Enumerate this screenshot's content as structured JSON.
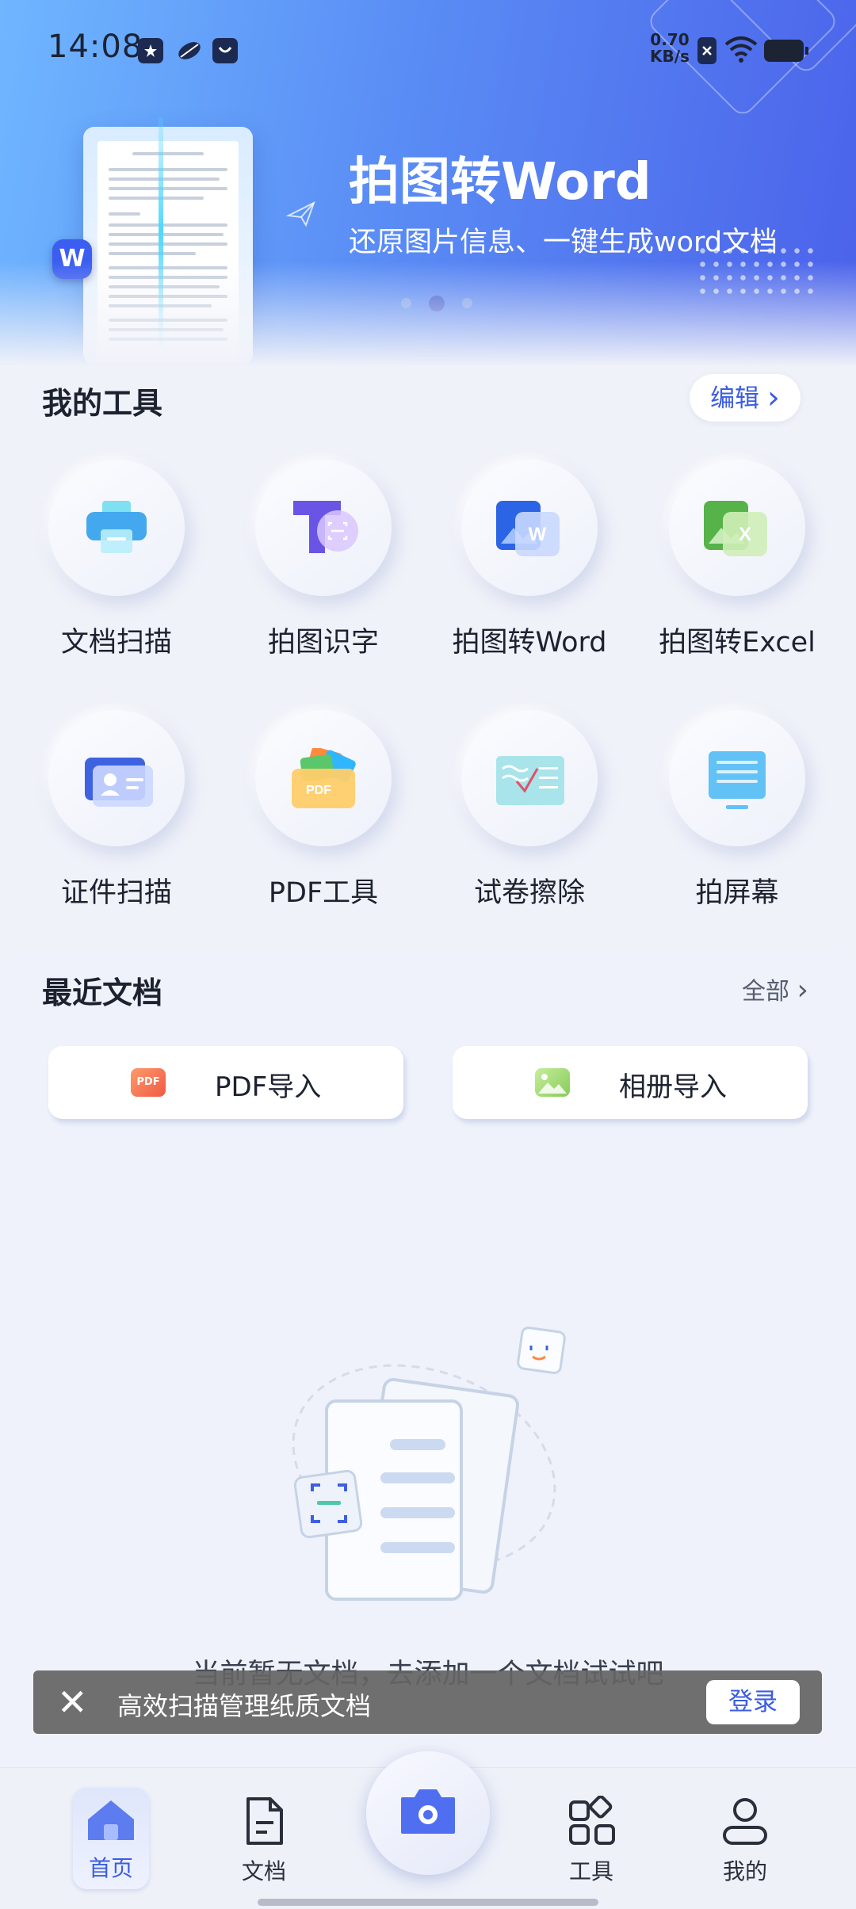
{
  "status_bar": {
    "time": "14:08",
    "speed_value": "0.70",
    "speed_unit": "KB/s",
    "icons": [
      "app-notification-icon",
      "leaf-icon",
      "bag-icon",
      "x-notification-icon",
      "wifi-icon",
      "battery-icon"
    ]
  },
  "banner": {
    "title": "拍图转Word",
    "subtitle": "还原图片信息、一键生成word文档",
    "badge": "W",
    "slides_count": 3,
    "active_slide": 1
  },
  "my_tools": {
    "title": "我的工具",
    "edit_label": "编辑",
    "edit_chevron": "›",
    "items": [
      {
        "label": "文档扫描",
        "icon": "printer-scan-icon"
      },
      {
        "label": "拍图识字",
        "icon": "text-recognize-icon"
      },
      {
        "label": "拍图转Word",
        "icon": "word-convert-icon"
      },
      {
        "label": "拍图转Excel",
        "icon": "excel-convert-icon"
      },
      {
        "label": "证件扫描",
        "icon": "id-card-icon"
      },
      {
        "label": "PDF工具",
        "icon": "pdf-tools-icon"
      },
      {
        "label": "试卷擦除",
        "icon": "exam-erase-icon"
      },
      {
        "label": "拍屏幕",
        "icon": "screen-capture-icon"
      }
    ]
  },
  "recent_docs": {
    "title": "最近文档",
    "all_label": "全部",
    "all_chevron": "›",
    "pdf_import": "PDF导入",
    "pdf_icon_text": "PDF",
    "album_import": "相册导入",
    "empty_text": "当前暂无文档，去添加一个文档试试吧"
  },
  "toast": {
    "close_glyph": "✕",
    "text": "高效扫描管理纸质文档",
    "login_label": "登录"
  },
  "bottom_nav": {
    "home": "首页",
    "docs": "文档",
    "tools": "工具",
    "mine": "我的"
  },
  "colors": {
    "accent": "#3b5de0",
    "banner_start": "#6fb6ff",
    "banner_end": "#4b62ea",
    "background": "#f0f2f9"
  }
}
